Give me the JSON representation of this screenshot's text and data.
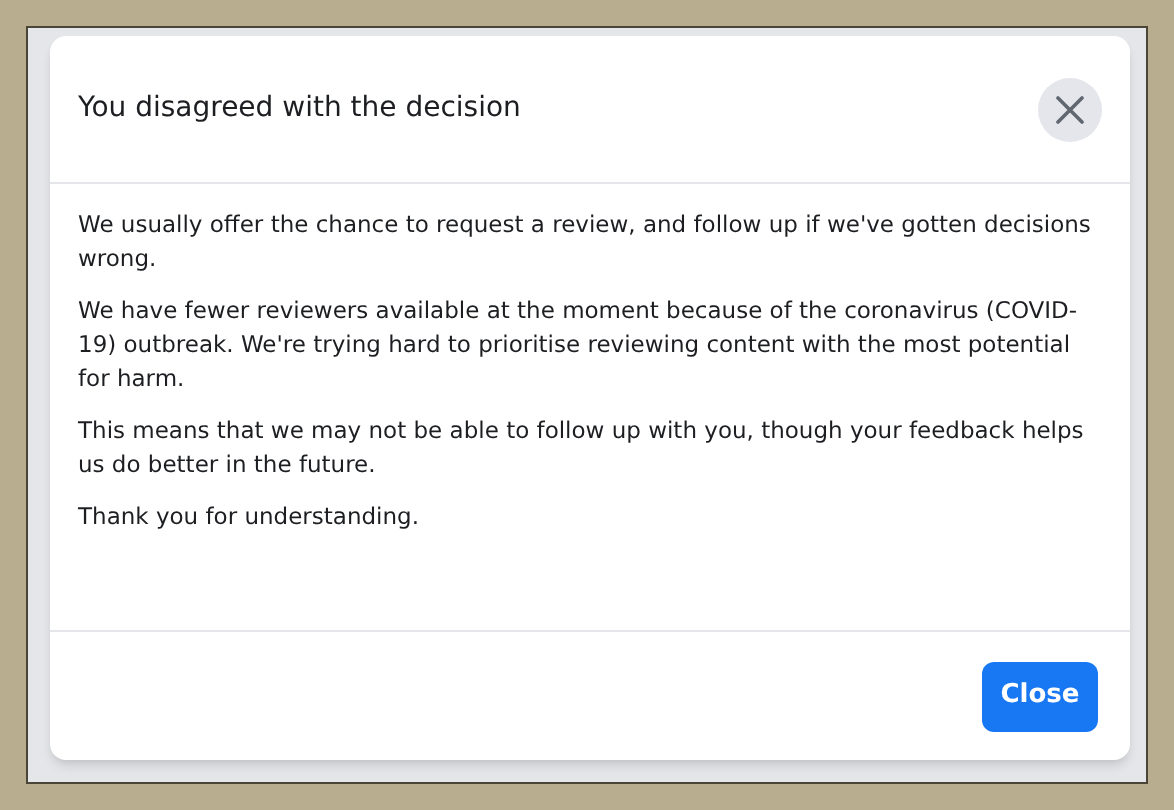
{
  "dialog": {
    "title": "You disagreed with the decision",
    "paragraphs": [
      "We usually offer the chance to request a review, and follow up if we've gotten decisions wrong.",
      "We have fewer reviewers available at the moment because of the coronavirus (COVID-19) outbreak. We're trying hard to prioritise reviewing content with the most potential for harm.",
      "This means that we may not be able to follow up with you, though your feedback helps us do better in the future.",
      "Thank you for understanding."
    ],
    "buttons": [
      "Close"
    ]
  }
}
